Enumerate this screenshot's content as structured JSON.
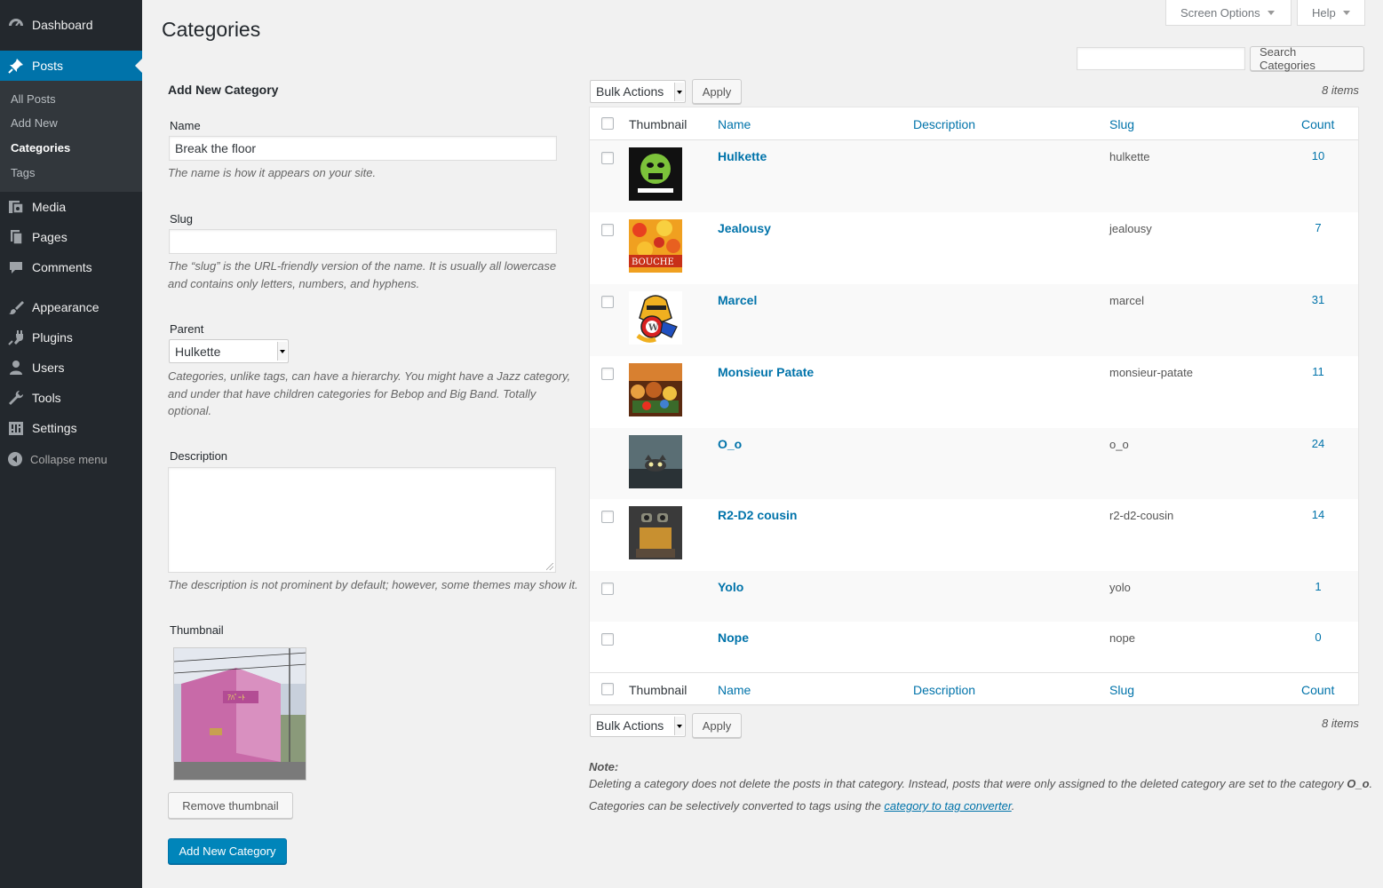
{
  "sidebar": {
    "items": [
      {
        "label": "Dashboard",
        "icon": "dashboard-icon"
      },
      {
        "label": "Posts",
        "icon": "pin-icon"
      },
      {
        "label": "Media",
        "icon": "media-icon"
      },
      {
        "label": "Pages",
        "icon": "pages-icon"
      },
      {
        "label": "Comments",
        "icon": "comments-icon"
      },
      {
        "label": "Appearance",
        "icon": "appearance-icon"
      },
      {
        "label": "Plugins",
        "icon": "plugins-icon"
      },
      {
        "label": "Users",
        "icon": "users-icon"
      },
      {
        "label": "Tools",
        "icon": "tools-icon"
      },
      {
        "label": "Settings",
        "icon": "settings-icon"
      }
    ],
    "submenu": [
      "All Posts",
      "Add New",
      "Categories",
      "Tags"
    ],
    "collapse_label": "Collapse menu"
  },
  "header": {
    "screen_options": "Screen Options",
    "help": "Help",
    "title": "Categories"
  },
  "search": {
    "value": "",
    "button": "Search Categories"
  },
  "form": {
    "heading": "Add New Category",
    "name_label": "Name",
    "name_value": "Break the floor",
    "name_help": "The name is how it appears on your site.",
    "slug_label": "Slug",
    "slug_value": "",
    "slug_help": "The “slug” is the URL-friendly version of the name. It is usually all lowercase and contains only letters, numbers, and hyphens.",
    "parent_label": "Parent",
    "parent_value": "Hulkette",
    "parent_help": "Categories, unlike tags, can have a hierarchy. You might have a Jazz category, and under that have children categories for Bebop and Big Band. Totally optional.",
    "description_label": "Description",
    "description_help": "The description is not prominent by default; however, some themes may show it.",
    "thumbnail_label": "Thumbnail",
    "remove_thumbnail": "Remove thumbnail",
    "submit": "Add New Category"
  },
  "table": {
    "bulk_actions": "Bulk Actions",
    "apply": "Apply",
    "items_count": "8 items",
    "columns": {
      "thumbnail": "Thumbnail",
      "name": "Name",
      "description": "Description",
      "slug": "Slug",
      "count": "Count"
    },
    "rows": [
      {
        "name": "Hulkette",
        "slug": "hulkette",
        "count": "10",
        "thumb_color": "#5a8a2a"
      },
      {
        "name": "Jealousy",
        "slug": "jealousy",
        "count": "7",
        "thumb_color": "#e8a020",
        "thumb_text": "BOUCHE"
      },
      {
        "name": "Marcel",
        "slug": "marcel",
        "count": "31",
        "thumb_color": "#f0b020"
      },
      {
        "name": "Monsieur Patate",
        "slug": "monsieur-patate",
        "count": "11",
        "thumb_color": "#8a4a1a"
      },
      {
        "name": "O_o",
        "slug": "o_o",
        "count": "24",
        "thumb_color": "#4a5a60"
      },
      {
        "name": "R2-D2 cousin",
        "slug": "r2-d2-cousin",
        "count": "14",
        "thumb_color": "#6a5030"
      },
      {
        "name": "Yolo",
        "slug": "yolo",
        "count": "1",
        "thumb_color": ""
      },
      {
        "name": "Nope",
        "slug": "nope",
        "count": "0",
        "thumb_color": ""
      }
    ]
  },
  "note": {
    "heading": "Note:",
    "line1_pre": "Deleting a category does not delete the posts in that category. Instead, posts that were only assigned to the deleted category are set to the category ",
    "line1_bold": "O_o",
    "line1_post": ".",
    "line2_pre": "Categories can be selectively converted to tags using the ",
    "line2_link": "category to tag converter",
    "line2_post": "."
  },
  "colors": {
    "sidebar_bg": "#23282d",
    "accent": "#0073aa",
    "primary_button": "#0085ba"
  }
}
